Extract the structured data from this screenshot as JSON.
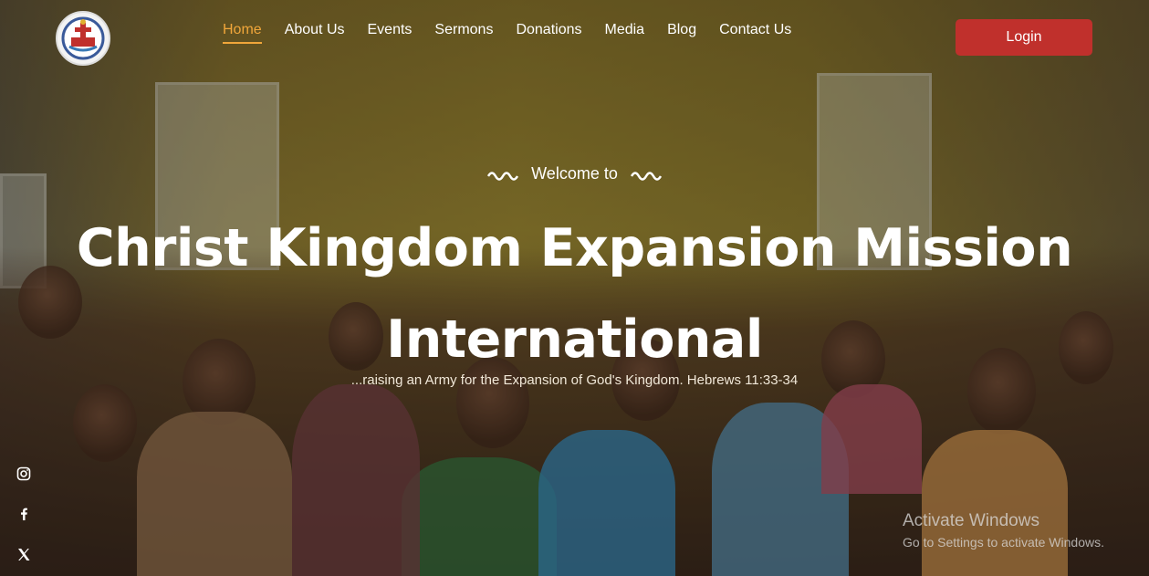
{
  "nav": {
    "items": [
      {
        "label": "Home",
        "active": true
      },
      {
        "label": "About Us"
      },
      {
        "label": "Events"
      },
      {
        "label": "Sermons"
      },
      {
        "label": "Donations"
      },
      {
        "label": "Media"
      },
      {
        "label": "Blog"
      },
      {
        "label": "Contact Us"
      }
    ],
    "login_label": "Login"
  },
  "hero": {
    "welcome": "Welcome to",
    "title_line1": "Christ Kingdom Expansion Mission",
    "title_line2": "International",
    "tagline": "...raising an Army for the Expansion of God's Kingdom. Hebrews 11:33-34"
  },
  "socials": [
    "instagram-icon",
    "facebook-icon",
    "x-icon"
  ],
  "watermark": {
    "line1": "Activate Windows",
    "line2": "Go to Settings to activate Windows."
  },
  "colors": {
    "accent": "#f0a63a",
    "login_bg": "#c0302c"
  }
}
